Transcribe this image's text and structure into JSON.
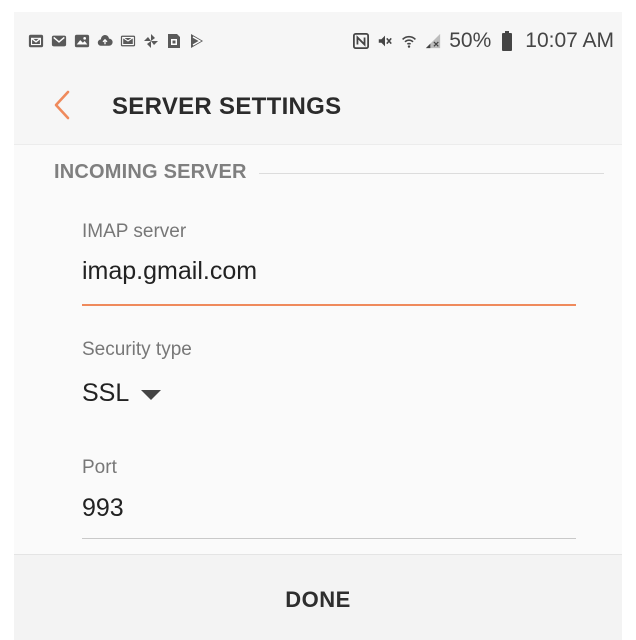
{
  "status_bar": {
    "notification_icons": [
      "gallery-mail-icon",
      "mail-icon",
      "image-icon",
      "cloud-upload-icon",
      "email-icon",
      "pinwheel-icon",
      "sim-card-icon",
      "play-store-icon"
    ],
    "system_icons": [
      "nfc-icon",
      "mute-icon",
      "wifi-icon",
      "signal-icon",
      "battery-icon"
    ],
    "battery": "50%",
    "time": "10:07 AM"
  },
  "app_bar": {
    "back_icon": "chevron-left-icon",
    "title": "SERVER SETTINGS"
  },
  "incoming_server": {
    "section_title": "INCOMING SERVER",
    "imap_server": {
      "label": "IMAP server",
      "value": "imap.gmail.com"
    },
    "security_type": {
      "label": "Security type",
      "value": "SSL"
    },
    "port": {
      "label": "Port",
      "value": "993"
    }
  },
  "actions": {
    "done_label": "DONE"
  },
  "colors": {
    "accent": "#ef8a5c",
    "text_primary": "#222222",
    "text_secondary": "#777777",
    "background": "#f6f6f6"
  }
}
